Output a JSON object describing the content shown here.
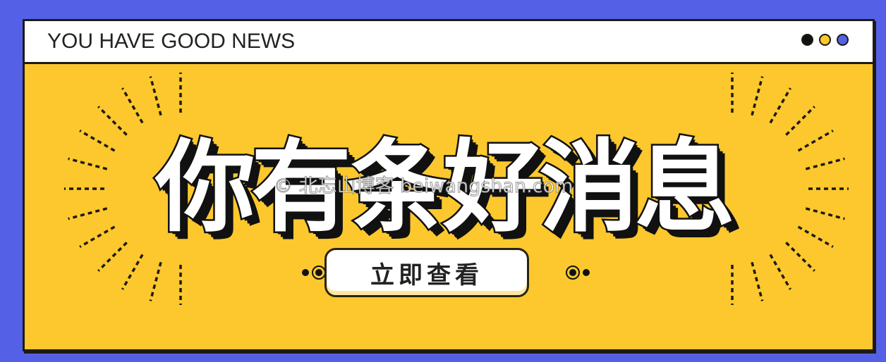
{
  "window": {
    "title": "YOU HAVE GOOD NEWS",
    "controls": [
      {
        "name": "black-dot",
        "color": "#111111"
      },
      {
        "name": "yellow-dot",
        "color": "#fcc82d"
      },
      {
        "name": "blue-dot",
        "color": "#5461e6"
      }
    ]
  },
  "headline": "你有条好消息",
  "cta": {
    "label": "立即查看"
  },
  "watermark": "© 北忘山博客 beiwangshan.com",
  "colors": {
    "background": "#5461e6",
    "panel": "#fcc82d",
    "ink": "#1d1a14",
    "white": "#ffffff"
  },
  "decorations": {
    "rays": "dashed-sunburst-icon",
    "ornaments": "dot-ring-icon"
  }
}
